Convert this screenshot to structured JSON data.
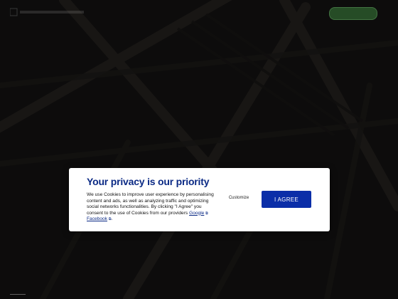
{
  "nav": {
    "links": [
      "",
      "",
      "",
      ""
    ],
    "cta_label": ""
  },
  "hero": {
    "line1": "",
    "line2": ""
  },
  "consent": {
    "title": "Your privacy is our priority",
    "body_text": "We use Cookies to improve user experience by personalising content and ads, as well as analyzing traffic and optimizing social networks functionalities. By clicking \"I Agree\" you consent to the use of Cookies from our providers",
    "link_google": "Google",
    "link_facebook": "Facebook",
    "customize_label": "Customize",
    "agree_label": "I AGREE"
  },
  "colors": {
    "accent": "#0b2ea8",
    "title": "#0b2a85",
    "overlay": "#141414"
  },
  "icons": {
    "external_link": "external-link-icon"
  }
}
